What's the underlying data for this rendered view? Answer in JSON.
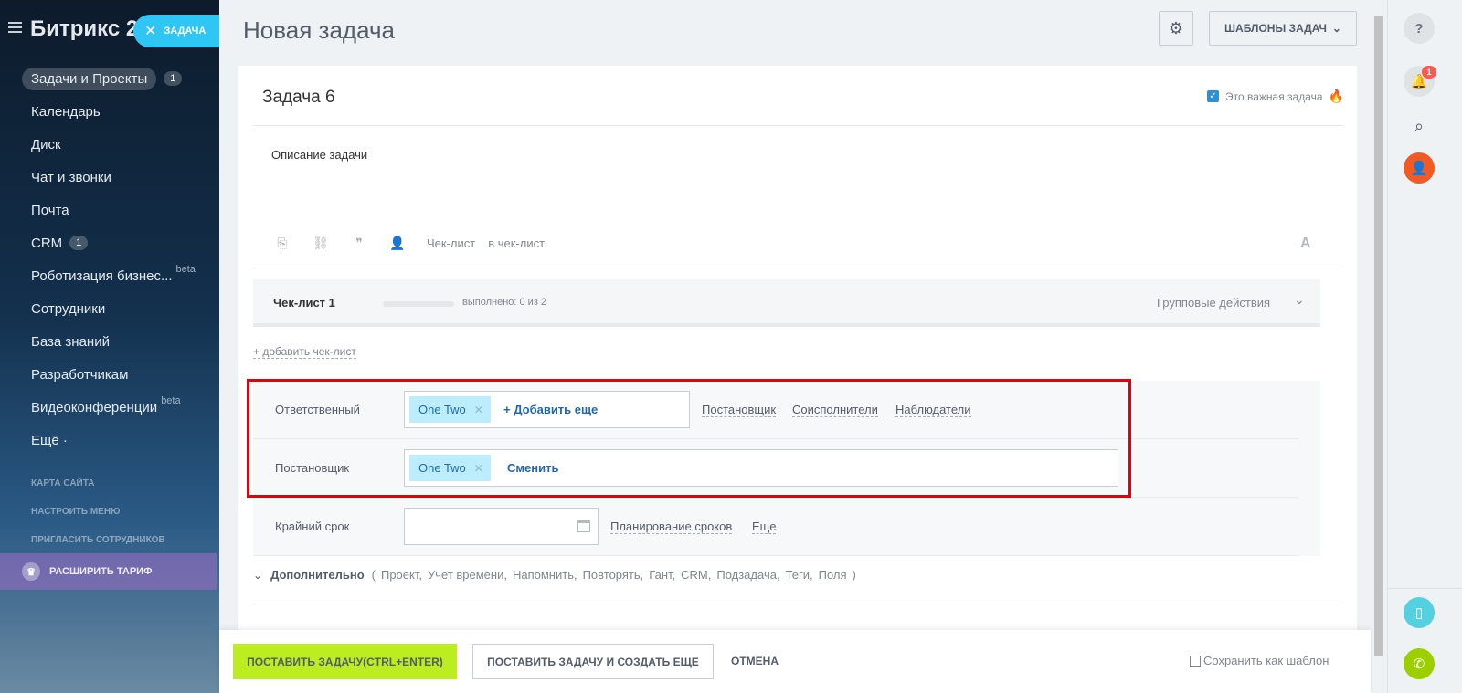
{
  "sidebar": {
    "brand": "Битрикс 24",
    "task_button": "ЗАДАЧА",
    "items": [
      {
        "label": "Задачи и Проекты",
        "badge": "1"
      },
      {
        "label": "Календарь"
      },
      {
        "label": "Диск"
      },
      {
        "label": "Чат и звонки"
      },
      {
        "label": "Почта"
      },
      {
        "label": "CRM",
        "badge": "1"
      },
      {
        "label": "Роботизация бизнес...",
        "tag": "beta"
      },
      {
        "label": "Сотрудники"
      },
      {
        "label": "База знаний"
      },
      {
        "label": "Разработчикам"
      },
      {
        "label": "Видеоконференции",
        "tag": "beta"
      },
      {
        "label": "Ещё ·"
      }
    ],
    "small_links": [
      "КАРТА САЙТА",
      "НАСТРОИТЬ МЕНЮ",
      "ПРИГЛАСИТЬ СОТРУДНИКОВ"
    ],
    "upgrade": "РАСШИРИТЬ ТАРИФ"
  },
  "header": {
    "title": "Новая задача",
    "templates": "ШАБЛОНЫ ЗАДАЧ"
  },
  "task": {
    "name": "Задача 6",
    "important_label": "Это важная задача",
    "description": "Описание задачи",
    "toolbar_checklist": "Чек-лист",
    "toolbar_to_checklist": "в чек-лист"
  },
  "checklist": {
    "title": "Чек-лист 1",
    "progress_text": "выполнено: 0 из 2",
    "progress_fraction": 0,
    "group_actions": "Групповые действия",
    "add": "+ добавить чек-лист"
  },
  "fields": {
    "responsible_label": "Ответственный",
    "responsible_user": "One Two",
    "add_more": "+ Добавить еще",
    "links": [
      "Постановщик",
      "Соисполнители",
      "Наблюдатели"
    ],
    "creator_label": "Постановщик",
    "creator_user": "One Two",
    "change": "Сменить",
    "deadline_label": "Крайний срок",
    "deadline_value": "",
    "planning": "Планирование сроков",
    "more": "Еще"
  },
  "additional": {
    "title": "Дополнительно",
    "open": "(",
    "items": [
      "Проект,",
      "Учет времени,",
      "Напомнить,",
      "Повторять,",
      "Гант,",
      "CRM,",
      "Подзадача,",
      "Теги,",
      "Поля"
    ],
    "close": ")"
  },
  "footer": {
    "primary": "ПОСТАВИТЬ ЗАДАЧУ(CTRL+ENTER)",
    "secondary": "ПОСТАВИТЬ ЗАДАЧУ И СОЗДАТЬ ЕЩЕ",
    "cancel": "ОТМЕНА",
    "save_template": "Сохранить как шаблон"
  },
  "rail": {
    "notification_count": "1"
  },
  "colors": {
    "accent": "#2fc6f6",
    "primary_button": "#bbed21",
    "chip": "#bcedfc",
    "highlight": "#e1000f"
  }
}
